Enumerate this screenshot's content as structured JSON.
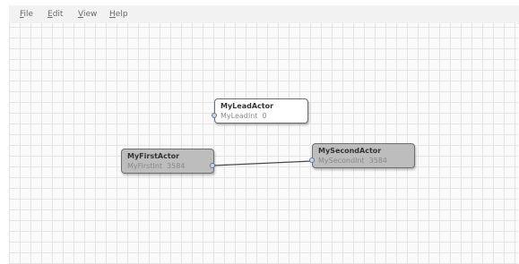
{
  "menubar": {
    "items": [
      {
        "label": "File",
        "mnemonic": "F",
        "rest": "ile"
      },
      {
        "label": "Edit",
        "mnemonic": "E",
        "rest": "dit"
      },
      {
        "label": "View",
        "mnemonic": "V",
        "rest": "iew"
      },
      {
        "label": "Help",
        "mnemonic": "H",
        "rest": "elp"
      }
    ]
  },
  "graph": {
    "nodes": {
      "lead": {
        "title": "MyLeadActor",
        "prop_name": "MyLeadInt",
        "prop_value": "0",
        "selected": true
      },
      "first": {
        "title": "MyFirstActor",
        "prop_name": "MyFirstInt",
        "prop_value": "3584",
        "selected": false
      },
      "second": {
        "title": "MySecondActor",
        "prop_name": "MySecondInt",
        "prop_value": "3584",
        "selected": false
      }
    },
    "edges": [
      {
        "from": "first",
        "to": "second"
      }
    ]
  },
  "colors": {
    "canvas_bg": "#fafafa",
    "grid_line": "#e4e4e4",
    "node_selected_bg": "#ffffff",
    "node_bg": "#bdbdbd",
    "edge": "#4a4a4a",
    "port": "#5b7a99"
  }
}
